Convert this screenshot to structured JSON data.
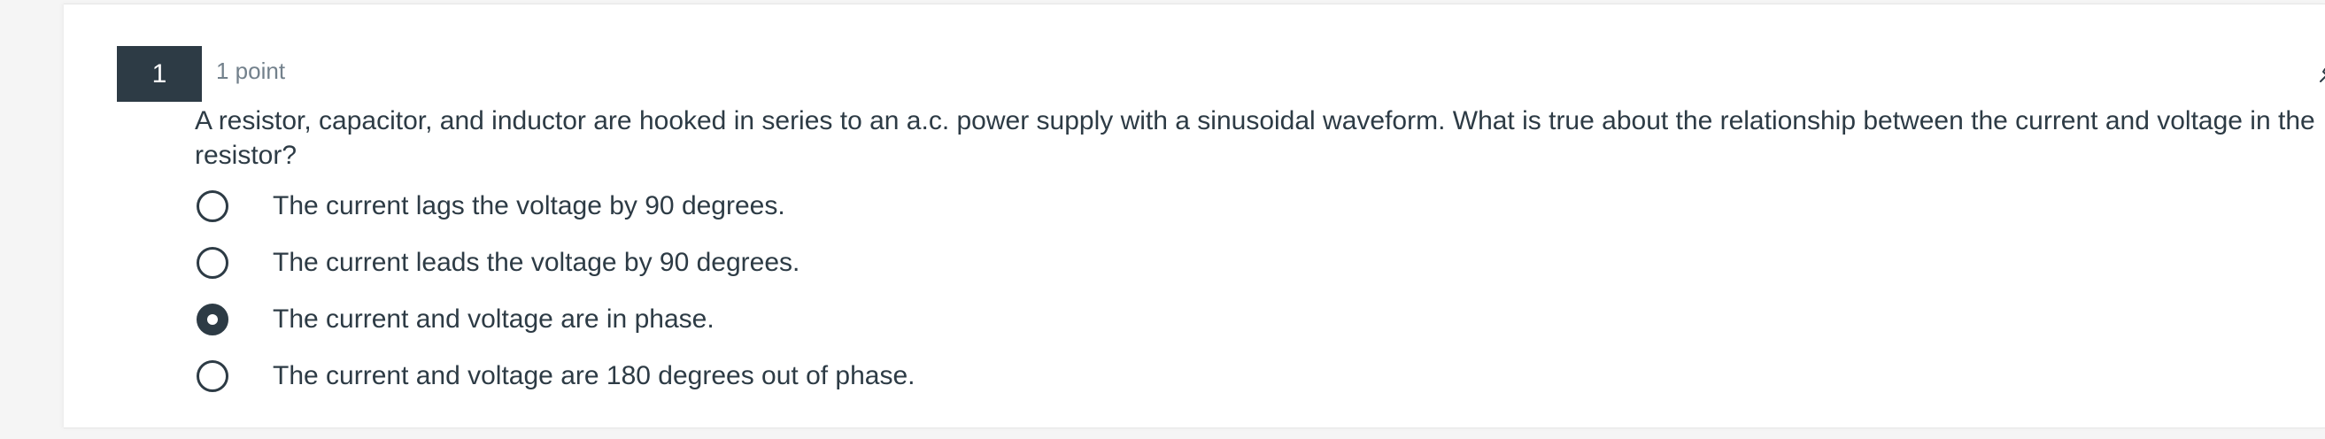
{
  "question": {
    "number": "1",
    "points": "1 point",
    "text": "A resistor, capacitor, and inductor are hooked in series to an a.c. power supply with a sinusoidal waveform.  What is true about the relationship between the current and voltage in the resistor?",
    "pin_icon": "pin-icon"
  },
  "options": [
    {
      "label": "The current lags the voltage by 90 degrees.",
      "selected": false
    },
    {
      "label": "The current leads the voltage by 90 degrees.",
      "selected": false
    },
    {
      "label": "The current and voltage are in phase.",
      "selected": true
    },
    {
      "label": "The current and voltage are 180 degrees out of phase.",
      "selected": false
    }
  ],
  "colors": {
    "primary": "#2d3b45",
    "muted": "#73818c",
    "background": "#f5f5f5"
  }
}
